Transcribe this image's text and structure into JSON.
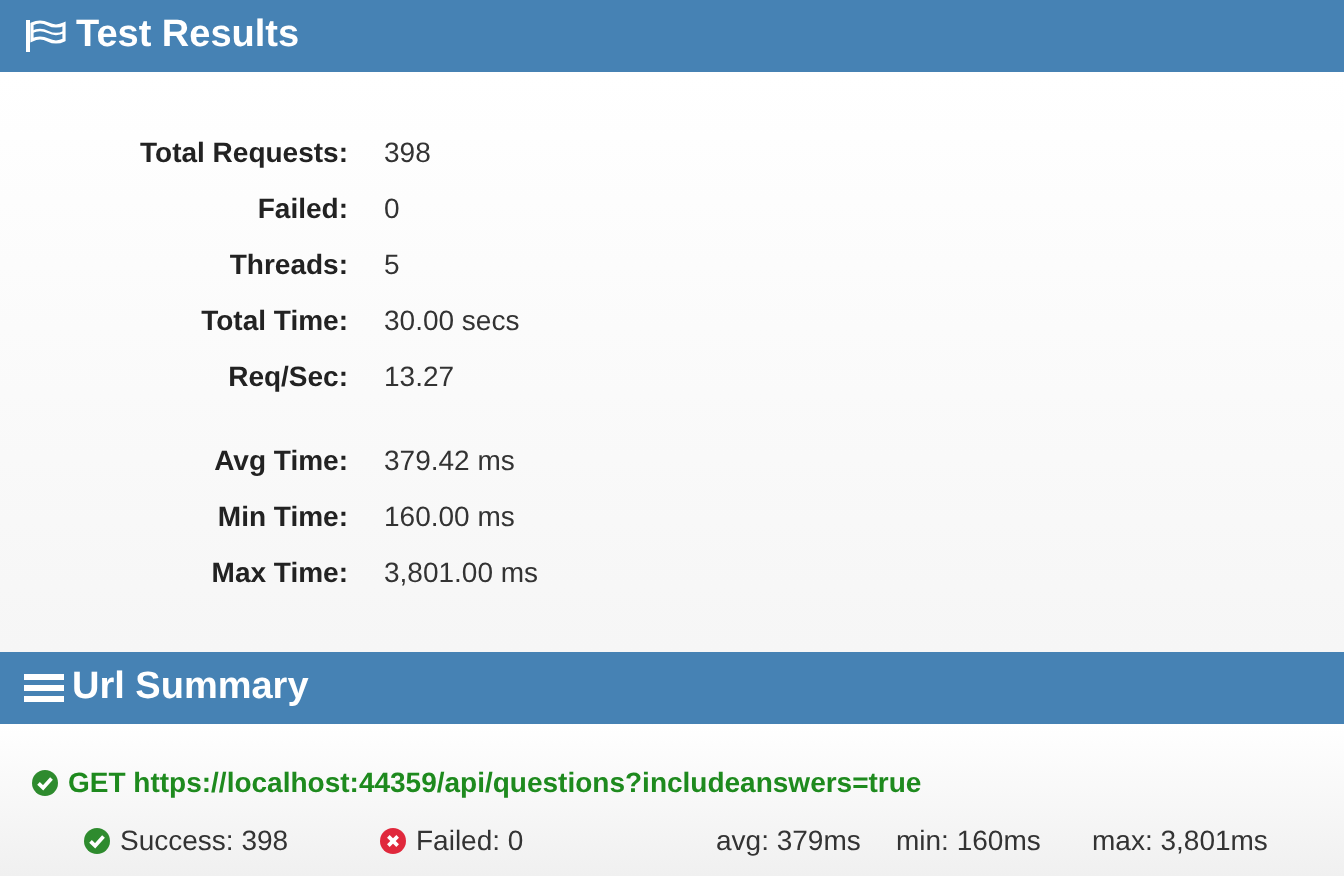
{
  "test_results": {
    "title": "Test Results",
    "stat_groups": [
      [
        {
          "label": "Total Requests:",
          "value": "398"
        },
        {
          "label": "Failed:",
          "value": "0"
        },
        {
          "label": "Threads:",
          "value": "5"
        },
        {
          "label": "Total Time:",
          "value": "30.00 secs"
        },
        {
          "label": "Req/Sec:",
          "value": "13.27"
        }
      ],
      [
        {
          "label": "Avg Time:",
          "value": "379.42 ms"
        },
        {
          "label": "Min Time:",
          "value": "160.00 ms"
        },
        {
          "label": "Max Time:",
          "value": "3,801.00 ms"
        }
      ]
    ]
  },
  "url_summary": {
    "title": "Url Summary",
    "urls": [
      {
        "request": "GET https://localhost:44359/api/questions?includeanswers=true",
        "success": "Success: 398",
        "failed": "Failed: 0",
        "avg": "avg: 379ms",
        "min": "min: 160ms",
        "max": "max: 3,801ms"
      }
    ]
  }
}
